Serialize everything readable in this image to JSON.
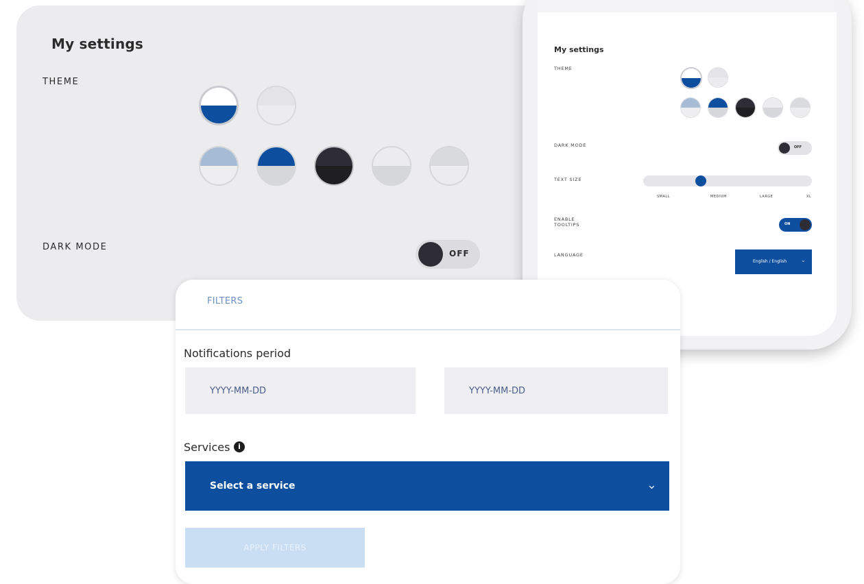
{
  "settings": {
    "title": "My settings",
    "theme_label": "THEME",
    "dark_mode_label": "DARK MODE",
    "dark_mode_toggle": "OFF"
  },
  "theme_swatches": [
    {
      "name": "blue-white",
      "top": "#ffffff",
      "bottom": "#0d4f9e",
      "selected": true
    },
    {
      "name": "light",
      "top": "#e4e4e8",
      "bottom": "#ececee",
      "selected": false
    }
  ],
  "accent_swatches": [
    {
      "name": "light-blue",
      "top": "#a5bcd4",
      "bottom": "#eeeef1"
    },
    {
      "name": "blue",
      "top": "#0d4f9e",
      "bottom": "#d6d7db"
    },
    {
      "name": "black",
      "top": "#2e2c34",
      "bottom": "#1f1f22"
    },
    {
      "name": "light-gray",
      "top": "#ececee",
      "bottom": "#d6d7db"
    },
    {
      "name": "lighter-gray",
      "top": "#d9dadd",
      "bottom": "#ececee"
    }
  ],
  "phone": {
    "title": "My settings",
    "theme_label": "THEME",
    "dark_mode_label": "DARK MODE",
    "dark_mode_toggle": "OFF",
    "text_size_label": "TEXT SIZE",
    "text_size_ticks": [
      "SMALL",
      "MEDIUM",
      "LARGE",
      "XL"
    ],
    "tooltips_label": "ENABLE\nTOOLTIPS",
    "tooltips_toggle": "ON",
    "language_label": "LANGUAGE",
    "language_value": "English / English"
  },
  "filters": {
    "tab": "FILTERS",
    "period_label": "Notifications period",
    "date_placeholder_start": "YYYY-MM-DD",
    "date_placeholder_end": "YYYY-MM-DD",
    "services_label": "Services",
    "service_select": "Select a service",
    "apply_button": "APPLY FILTERS"
  },
  "colors": {
    "accent": "#0d4f9e",
    "card_bg": "#ececee",
    "apply_disabled": "#c9def3"
  }
}
